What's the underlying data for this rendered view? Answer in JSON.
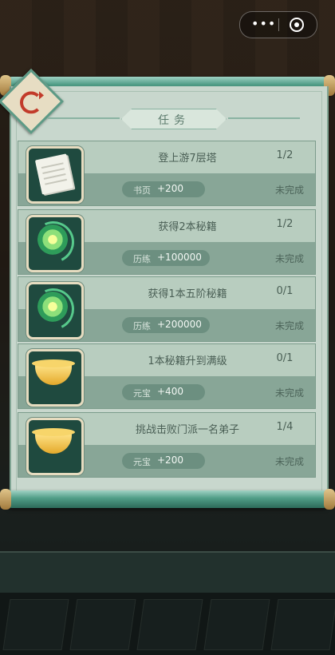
{
  "panel": {
    "title": "任务"
  },
  "tasks": [
    {
      "name": "登上游7层塔",
      "progress": "1/2",
      "reward_label": "书页",
      "reward_value": "+200",
      "status": "未完成",
      "icon": "paper-scroll-icon"
    },
    {
      "name": "获得2本秘籍",
      "progress": "1/2",
      "reward_label": "历练",
      "reward_value": "+100000",
      "status": "未完成",
      "icon": "jade-orb-icon"
    },
    {
      "name": "获得1本五阶秘籍",
      "progress": "0/1",
      "reward_label": "历练",
      "reward_value": "+200000",
      "status": "未完成",
      "icon": "jade-orb-icon"
    },
    {
      "name": "1本秘籍升到满级",
      "progress": "0/1",
      "reward_label": "元宝",
      "reward_value": "+400",
      "status": "未完成",
      "icon": "gold-ingot-icon"
    },
    {
      "name": "挑战击败门派一名弟子",
      "progress": "1/4",
      "reward_label": "元宝",
      "reward_value": "+200",
      "status": "未完成",
      "icon": "gold-ingot-icon"
    }
  ]
}
